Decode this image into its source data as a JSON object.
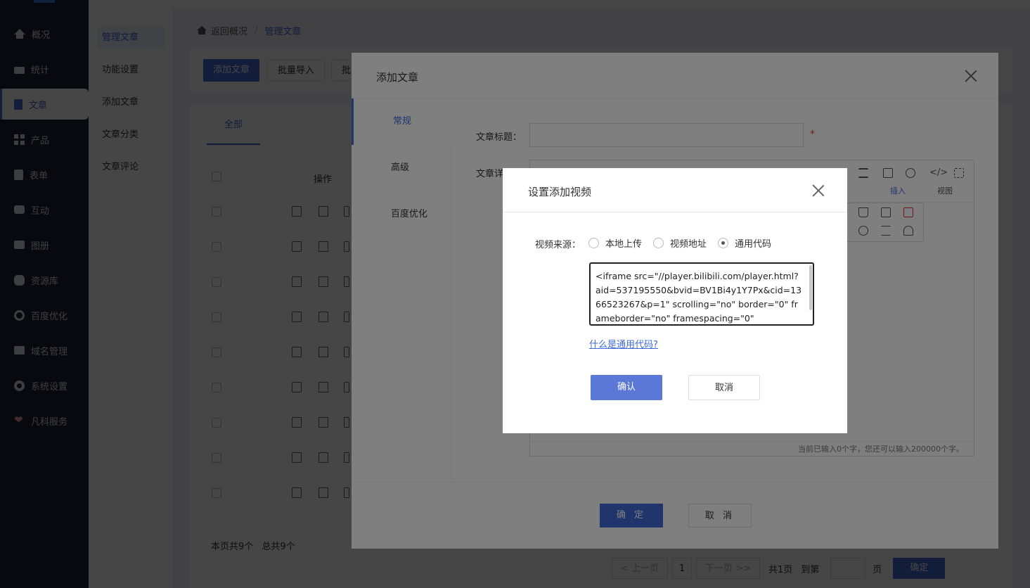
{
  "sidebar": {
    "items": [
      {
        "label": "概况",
        "icon": "home-icon"
      },
      {
        "label": "统计",
        "icon": "chart-icon"
      },
      {
        "label": "文章",
        "icon": "article-icon"
      },
      {
        "label": "产品",
        "icon": "grid-icon"
      },
      {
        "label": "表单",
        "icon": "form-icon"
      },
      {
        "label": "互动",
        "icon": "chat-icon"
      },
      {
        "label": "图册",
        "icon": "image-icon"
      },
      {
        "label": "资源库",
        "icon": "database-icon"
      },
      {
        "label": "百度优化",
        "icon": "seo-icon"
      },
      {
        "label": "域名管理",
        "icon": "domain-icon"
      },
      {
        "label": "系统设置",
        "icon": "gear-icon"
      },
      {
        "label": "凡科服务",
        "icon": "heart-icon"
      }
    ],
    "active_index": 2,
    "accent": "#3f6ad8"
  },
  "submenu": {
    "items": [
      "管理文章",
      "功能设置",
      "添加文章",
      "文章分类",
      "文章评论"
    ]
  },
  "breadcrumb": {
    "back": "返回概况",
    "separator": "/",
    "current": "管理文章"
  },
  "toolbar": {
    "add": "添加文章",
    "import": "批量导入",
    "batch": "批"
  },
  "list": {
    "tab_all": "全部",
    "col_op": "操作",
    "summary": "本页共9个",
    "total": "总共9个"
  },
  "pager": {
    "prev": "< 上一页",
    "page": "1",
    "next": "下一页 >>",
    "total_pages": "共1页",
    "goto": "到第",
    "page_unit": "页",
    "confirm": "确定"
  },
  "article_modal": {
    "title": "添加文章",
    "tabs": [
      "常规",
      "高级",
      "百度优化"
    ],
    "title_label": "文章标题：",
    "title_value": "",
    "required_mark": "*",
    "content_label": "文章详",
    "toolbar_insert": "插入",
    "toolbar_view": "视图",
    "word_count": "当前已输入0个字，您还可以输入200000个字。",
    "ok": "确 定",
    "cancel": "取 消"
  },
  "video_dialog": {
    "title": "设置添加视频",
    "source_label": "视频来源：",
    "options": [
      "本地上传",
      "视频地址",
      "通用代码"
    ],
    "selected_index": 2,
    "code_value": "<iframe src=\"//player.bilibili.com/player.html?aid=537195550&bvid=BV1Bi4y1Y7Px&cid=1366523267&p=1\" scrolling=\"no\" border=\"0\" frameborder=\"no\" framespacing=\"0\"",
    "help_link": "什么是通用代码?",
    "confirm": "确认",
    "cancel": "取消",
    "confirm_color": "#5b78d6"
  }
}
